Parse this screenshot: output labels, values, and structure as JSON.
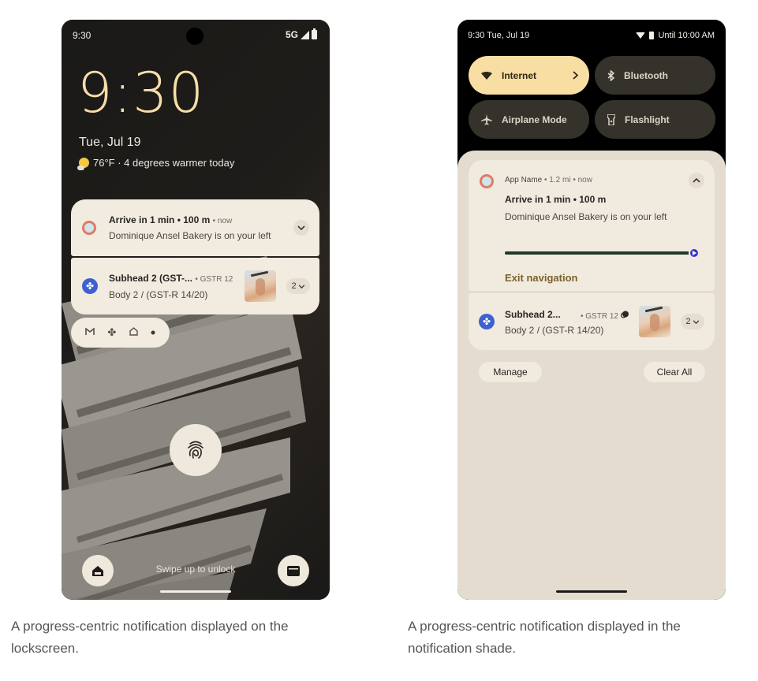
{
  "lockscreen": {
    "status": {
      "time": "9:30",
      "network": "5G"
    },
    "clock": "9:30",
    "date": "Tue, Jul 19",
    "weather": "76°F · 4 degrees warmer today",
    "notifications": [
      {
        "title": "Arrive in 1 min • 100 m",
        "meta": "• now",
        "body": "Dominique Ansel Bakery is on your left",
        "icon": "navigation-app-icon",
        "expand_icon": "chevron-down-icon"
      },
      {
        "title": "Subhead 2 (GST-...",
        "meta": "• GSTR 12",
        "body": "Body 2 / (GST-R 14/20)",
        "icon": "fan-app-icon",
        "count": "2"
      }
    ],
    "mini_icons": [
      "gmail-icon",
      "fan-icon",
      "home-icon",
      "more-dot-icon"
    ],
    "swipe_hint": "Swipe up to unlock"
  },
  "shade": {
    "status": {
      "time_date": "9:30  Tue, Jul 19",
      "right_text": "Until 10:00 AM"
    },
    "tiles": [
      {
        "label": "Internet",
        "state": "on",
        "icon": "wifi-icon"
      },
      {
        "label": "Bluetooth",
        "state": "off",
        "icon": "bluetooth-icon"
      },
      {
        "label": "Airplane Mode",
        "state": "off",
        "icon": "airplane-icon"
      },
      {
        "label": "Flashlight",
        "state": "off",
        "icon": "flashlight-icon"
      }
    ],
    "notifications": [
      {
        "app_name": "App Name",
        "meta": "• 1.2 mi • now",
        "title": "Arrive in 1 min • 100 m",
        "body": "Dominique Ansel Bakery is on your left",
        "progress": 1.0,
        "action": "Exit navigation"
      },
      {
        "title": "Subhead 2...",
        "meta": "• GSTR 12",
        "body": "Body 2 / (GST-R 14/20)",
        "count": "2"
      }
    ],
    "manage_label": "Manage",
    "clear_all_label": "Clear All"
  },
  "captions": {
    "left": "A progress-centric notification displayed on the lockscreen.",
    "right": "A progress-centric notification displayed in the notification shade."
  },
  "colors": {
    "clock": "#f6dea8",
    "tile_on": "#f9dea3",
    "tile_off": "#35322c",
    "progress_fill": "#1f3a2a",
    "progress_thumb": "#3a35c9",
    "action_text": "#7a6329"
  }
}
